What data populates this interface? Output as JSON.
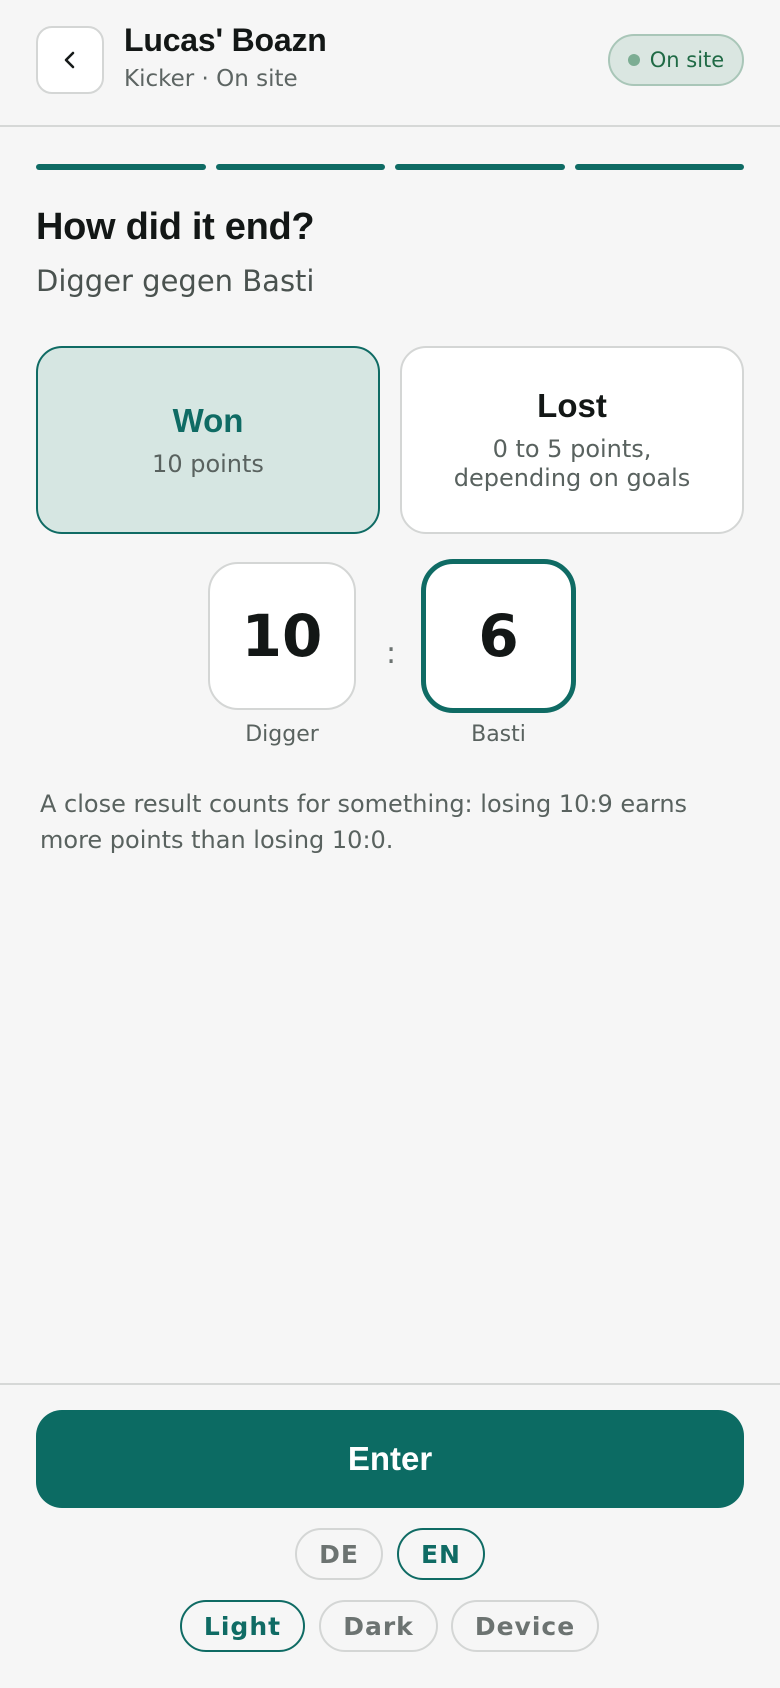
{
  "header": {
    "title": "Lucas' Boazn",
    "subtitle": "Kicker · On site",
    "back_icon": "chevron-left-icon",
    "status_badge": "On site",
    "status_color": "#7cad93"
  },
  "progress": {
    "steps_total": 4,
    "steps_completed": 4,
    "color": "#0f6b64"
  },
  "question": {
    "title": "How did it end?",
    "matchup": "Digger gegen Basti"
  },
  "outcome": {
    "selected": "won",
    "options": [
      {
        "id": "won",
        "title": "Won",
        "description": "10 points"
      },
      {
        "id": "lost",
        "title": "Lost",
        "description": "0 to 5 points, depending on goals"
      }
    ]
  },
  "score": {
    "separator": ":",
    "home": {
      "value": "10",
      "player": "Digger"
    },
    "away": {
      "value": "6",
      "player": "Basti",
      "focused": true
    }
  },
  "hint": "A close result counts for something: losing 10:9 earns more points than losing 10:0.",
  "footer": {
    "enter_label": "Enter",
    "languages": [
      "DE",
      "EN"
    ],
    "selected_language": "EN",
    "themes": [
      "Light",
      "Dark",
      "Device"
    ],
    "selected_theme": "Light"
  },
  "colors": {
    "accent": "#0f6b64",
    "background": "#f6f6f6",
    "selected_fill": "#d6e6e2",
    "status_badge_bg": "#dae6e1"
  }
}
